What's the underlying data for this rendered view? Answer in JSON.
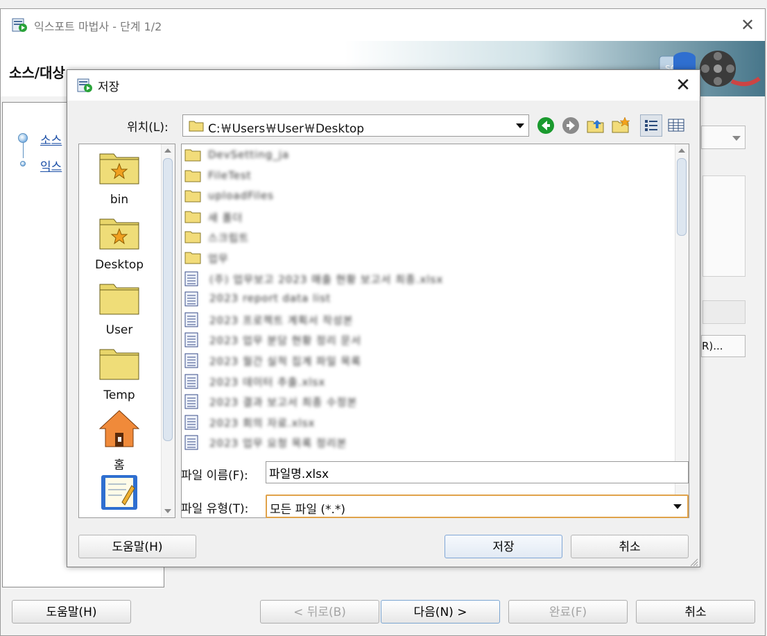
{
  "wizard": {
    "title": "익스포트 마법사 - 단계 1/2",
    "heading": "소스/대상",
    "steps": [
      {
        "label": "소스"
      },
      {
        "label": "익스"
      }
    ],
    "partial_button_label": "R)...",
    "buttons": {
      "help": "도움말(H)",
      "back": "< 뒤로(B)",
      "next": "다음(N) >",
      "finish": "완료(F)",
      "cancel": "취소"
    }
  },
  "dialog": {
    "title": "저장",
    "location_label": "위치(L):",
    "location_value": "C:￦Users￦User￦Desktop",
    "places": [
      {
        "label": "bin",
        "icon": "starred-folder-icon"
      },
      {
        "label": "Desktop",
        "icon": "starred-folder-icon"
      },
      {
        "label": "User",
        "icon": "folder-icon"
      },
      {
        "label": "Temp",
        "icon": "folder-icon"
      },
      {
        "label": "홈",
        "icon": "home-icon"
      },
      {
        "label": "",
        "icon": "document-icon"
      }
    ],
    "files": [
      {
        "name": "DevSetting_ja",
        "type": "folder"
      },
      {
        "name": "FileTest",
        "type": "folder"
      },
      {
        "name": "uploadFiles",
        "type": "folder"
      },
      {
        "name": "새 폴더",
        "type": "folder"
      },
      {
        "name": "스크립트",
        "type": "folder"
      },
      {
        "name": "업무",
        "type": "folder"
      },
      {
        "name": "(주) 업무보고 2023 매출 현황 보고서 최종.xlsx",
        "type": "file"
      },
      {
        "name": "2023 report data list",
        "type": "file"
      },
      {
        "name": "2023 프로젝트 계획서 작성본",
        "type": "file"
      },
      {
        "name": "2023 업무 분담 현황 정리 문서",
        "type": "file"
      },
      {
        "name": "2023 월간 실적 집계 파일 목록",
        "type": "file"
      },
      {
        "name": "2023 데이터 추출.xlsx",
        "type": "file"
      },
      {
        "name": "2023 결과 보고서 최종 수정본",
        "type": "file"
      },
      {
        "name": "2023 회의 자료.xlsx",
        "type": "file"
      },
      {
        "name": "2023 업무 요청 목록 정리본",
        "type": "file"
      }
    ],
    "filename_label": "파일 이름(F):",
    "filename_value": "파일명.xlsx",
    "filetype_label": "파일 유형(T):",
    "filetype_value": "모든 파일 (*.*)",
    "buttons": {
      "help": "도움말(H)",
      "save": "저장",
      "cancel": "취소"
    }
  },
  "colors": {
    "accent_focus": "#e0a24a",
    "link_blue": "#1a4ea6",
    "nav_green": "#1a9a2e"
  }
}
